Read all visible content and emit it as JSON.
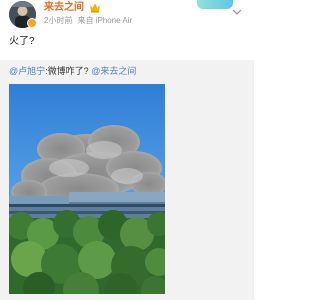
{
  "post": {
    "author": {
      "name": "来去之间",
      "avatar": "avatar-photo",
      "verified_icon": "verified-badge-icon",
      "vip_icon": "vip-crown-icon"
    },
    "meta": {
      "time": "2小时前",
      "source": "来自 iPhone Air"
    },
    "text": "火了?",
    "repost": {
      "mention_author": "@卢旭宁",
      "separator": ":",
      "text": "微博咋了?",
      "mention_target": "@来去之间",
      "image": "smoke-over-building-photo"
    }
  },
  "colors": {
    "author_name": "#e86b1f",
    "mention": "#4a7dbf",
    "repost_background": "#f2f2f2",
    "meta": "#9a9a9a"
  }
}
